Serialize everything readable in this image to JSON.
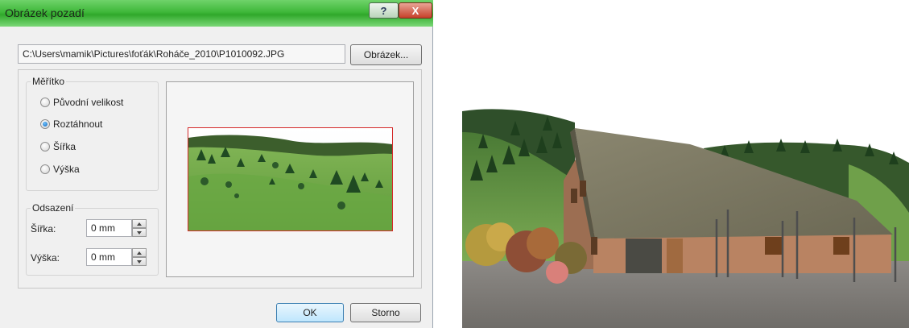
{
  "dialog": {
    "title": "Obrázek pozadí",
    "help_glyph": "?",
    "close_glyph": "X",
    "file_path": "C:\\Users\\mamik\\Pictures\\foťák\\Roháče_2010\\P1010092.JPG",
    "browse_label": "Obrázek...",
    "scale": {
      "legend": "Měřítko",
      "options": [
        {
          "label": "Původní velikost",
          "checked": false
        },
        {
          "label": "Roztáhnout",
          "checked": true
        },
        {
          "label": "Šířka",
          "checked": false
        },
        {
          "label": "Výška",
          "checked": false
        }
      ]
    },
    "offset": {
      "legend": "Odsazení",
      "width_label": "Šířka:",
      "width_value": "0 mm",
      "height_label": "Výška:",
      "height_value": "0 mm"
    },
    "ok_label": "OK",
    "cancel_label": "Storno"
  },
  "colors": {
    "titlebar": "#3fb83a",
    "preview_border": "#d42a2a",
    "roof": "#7d7a66",
    "brick": "#b98362",
    "sky": "#ffffff",
    "hills": "#4f7a38",
    "ground": "#807d78"
  }
}
